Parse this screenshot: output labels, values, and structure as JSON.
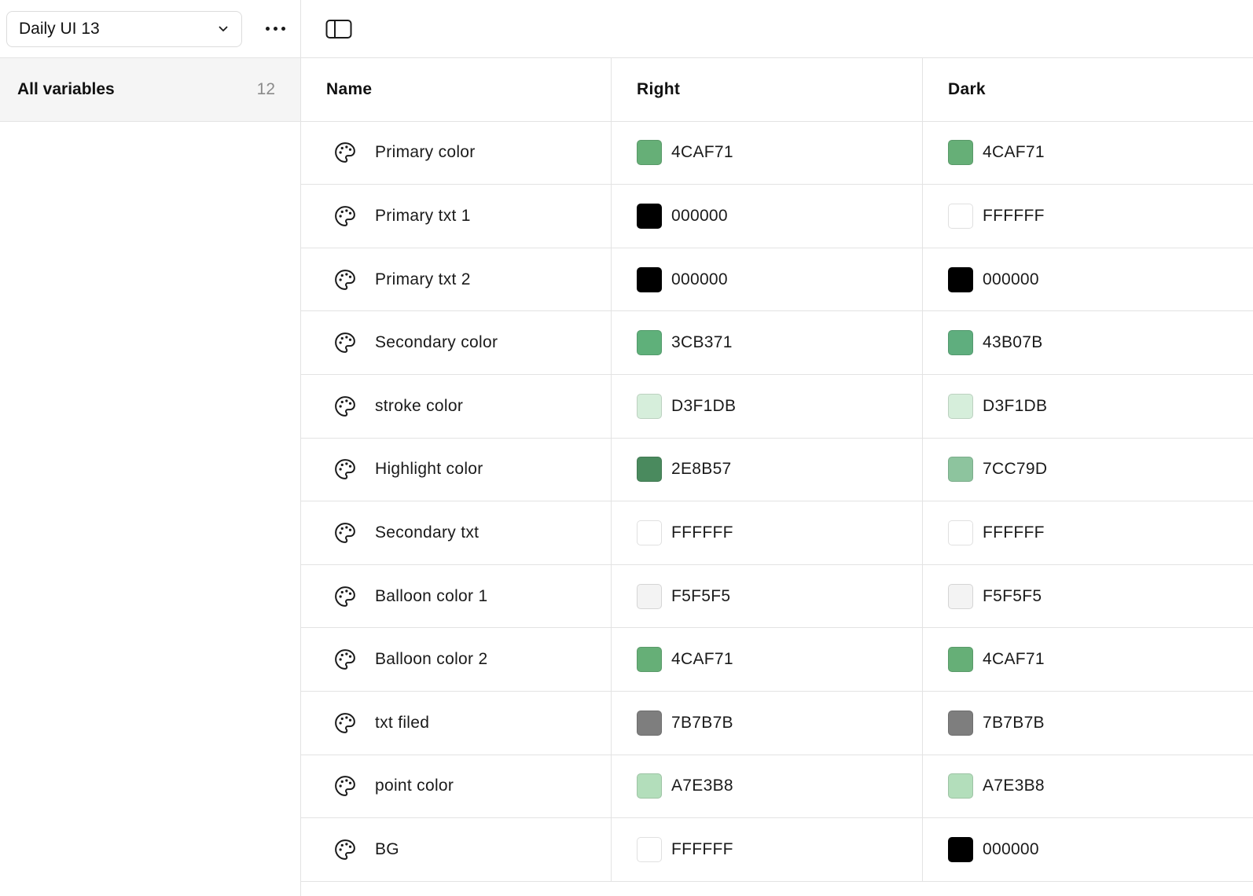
{
  "sidebar": {
    "collection_name": "Daily UI 13",
    "all_variables_label": "All variables",
    "all_variables_count": "12"
  },
  "table": {
    "columns": [
      "Name",
      "Right",
      "Dark"
    ],
    "rows": [
      {
        "name": "Primary color",
        "right": "4CAF71",
        "right_color": "#66AF77",
        "dark": "4CAF71",
        "dark_color": "#66AF77"
      },
      {
        "name": "Primary txt 1",
        "right": "000000",
        "right_color": "#000000",
        "dark": "FFFFFF",
        "dark_color": "#FFFFFF"
      },
      {
        "name": "Primary txt 2",
        "right": "000000",
        "right_color": "#000000",
        "dark": "000000",
        "dark_color": "#000000"
      },
      {
        "name": "Secondary color",
        "right": "3CB371",
        "right_color": "#5FB07A",
        "dark": "43B07B",
        "dark_color": "#5FAE7E"
      },
      {
        "name": "stroke color",
        "right": "D3F1DB",
        "right_color": "#D6EEDB",
        "dark": "D3F1DB",
        "dark_color": "#D6EEDB"
      },
      {
        "name": "Highlight color",
        "right": "2E8B57",
        "right_color": "#4A8A5E",
        "dark": "7CC79D",
        "dark_color": "#8DC49E"
      },
      {
        "name": "Secondary txt",
        "right": "FFFFFF",
        "right_color": "#FFFFFF",
        "dark": "FFFFFF",
        "dark_color": "#FFFFFF"
      },
      {
        "name": "Balloon color 1",
        "right": "F5F5F5",
        "right_color": "#F3F3F3",
        "dark": "F5F5F5",
        "dark_color": "#F3F3F3"
      },
      {
        "name": "Balloon color 2",
        "right": "4CAF71",
        "right_color": "#66AF77",
        "dark": "4CAF71",
        "dark_color": "#66AF77"
      },
      {
        "name": "txt filed",
        "right": "7B7B7B",
        "right_color": "#7E7E7E",
        "dark": "7B7B7B",
        "dark_color": "#7E7E7E"
      },
      {
        "name": "point color",
        "right": "A7E3B8",
        "right_color": "#B3DEBB",
        "dark": "A7E3B8",
        "dark_color": "#B3DEBB"
      },
      {
        "name": "BG",
        "right": "FFFFFF",
        "right_color": "#FFFFFF",
        "dark": "000000",
        "dark_color": "#000000"
      }
    ]
  },
  "icons": {
    "collection_dropdown": "chevron-down-icon",
    "more_menu": "more-horizontal-icon",
    "panel_toggle": "sidebar-panel-icon",
    "variable_type": "palette-icon"
  }
}
